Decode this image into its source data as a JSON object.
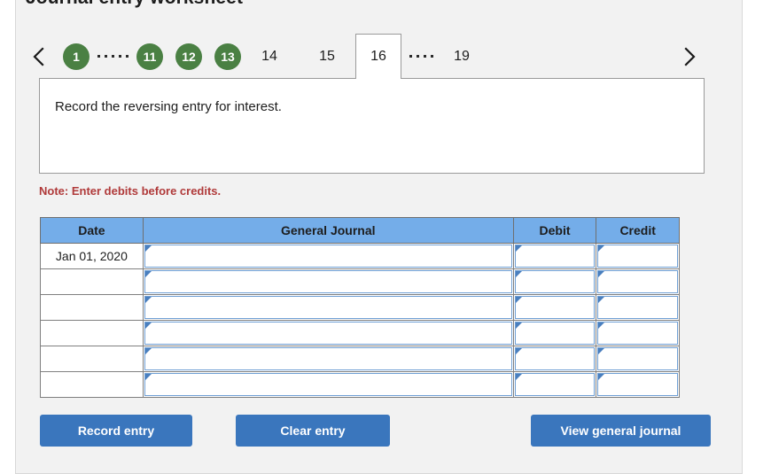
{
  "worksheet": {
    "title": "Journal entry worksheet",
    "instruction": "Record the reversing entry for interest.",
    "note": "Note: Enter debits before credits."
  },
  "tabs": {
    "prev_icon": "chevron-left-icon",
    "next_icon": "chevron-right-icon",
    "active": "16",
    "items": [
      {
        "label": "1",
        "state": "completed"
      },
      {
        "label": "11",
        "state": "completed"
      },
      {
        "label": "12",
        "state": "completed"
      },
      {
        "label": "13",
        "state": "completed"
      },
      {
        "label": "14",
        "state": "plain"
      },
      {
        "label": "15",
        "state": "plain"
      },
      {
        "label": "16",
        "state": "active"
      },
      {
        "label": "19",
        "state": "plain"
      }
    ]
  },
  "table": {
    "headers": {
      "date": "Date",
      "general_journal": "General Journal",
      "debit": "Debit",
      "credit": "Credit"
    },
    "rows": [
      {
        "date": "Jan 01, 2020",
        "account": "",
        "debit": "",
        "credit": ""
      },
      {
        "date": "",
        "account": "",
        "debit": "",
        "credit": ""
      },
      {
        "date": "",
        "account": "",
        "debit": "",
        "credit": ""
      },
      {
        "date": "",
        "account": "",
        "debit": "",
        "credit": ""
      },
      {
        "date": "",
        "account": "",
        "debit": "",
        "credit": ""
      },
      {
        "date": "",
        "account": "",
        "debit": "",
        "credit": ""
      }
    ]
  },
  "buttons": {
    "record": "Record entry",
    "clear": "Clear entry",
    "view": "View general journal"
  },
  "colors": {
    "tab_completed": "#4a8043",
    "table_header": "#74ade9",
    "button": "#3a76bd",
    "note": "#b03a3a",
    "panel": "#f2f2f2",
    "field_border": "#6f9fd4"
  }
}
